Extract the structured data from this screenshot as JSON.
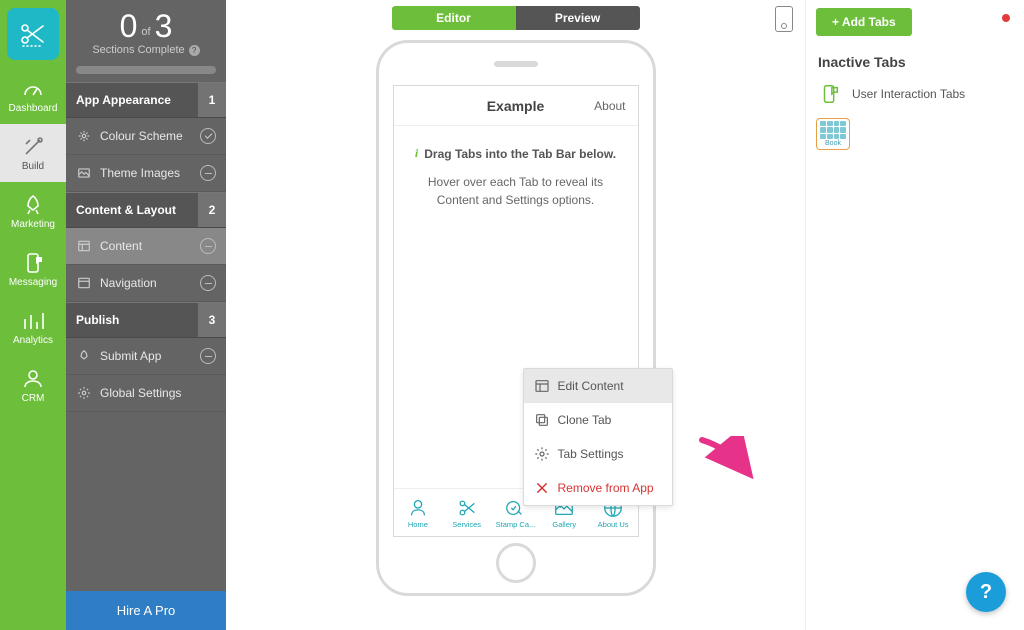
{
  "rail": {
    "items": [
      {
        "label": "Dashboard"
      },
      {
        "label": "Build"
      },
      {
        "label": "Marketing"
      },
      {
        "label": "Messaging"
      },
      {
        "label": "Analytics"
      },
      {
        "label": "CRM"
      }
    ]
  },
  "progress": {
    "done": "0",
    "of_word": "of",
    "total": "3",
    "subtitle": "Sections Complete"
  },
  "sidebar": {
    "sections": [
      {
        "title": "App Appearance",
        "step": "1",
        "items": [
          {
            "label": "Colour Scheme"
          },
          {
            "label": "Theme Images"
          }
        ]
      },
      {
        "title": "Content & Layout",
        "step": "2",
        "items": [
          {
            "label": "Content"
          },
          {
            "label": "Navigation"
          }
        ]
      },
      {
        "title": "Publish",
        "step": "3",
        "items": [
          {
            "label": "Submit App"
          },
          {
            "label": "Global Settings"
          }
        ]
      }
    ],
    "hire": "Hire A Pro"
  },
  "topbar": {
    "editor": "Editor",
    "preview": "Preview"
  },
  "screen": {
    "title": "Example",
    "about": "About",
    "hint_line1": "Drag Tabs into the Tab Bar below.",
    "hint_line2": "Hover over each Tab to reveal its Content and Settings options."
  },
  "tabbar": [
    {
      "label": "Home"
    },
    {
      "label": "Services"
    },
    {
      "label": "Stamp Ca..."
    },
    {
      "label": "Gallery"
    },
    {
      "label": "About Us"
    }
  ],
  "ctx": {
    "edit": "Edit Content",
    "clone": "Clone Tab",
    "settings": "Tab Settings",
    "remove": "Remove from App"
  },
  "right": {
    "add": "+ Add Tabs",
    "inactive_heading": "Inactive Tabs",
    "inactive": [
      {
        "label": "User Interaction Tabs"
      }
    ],
    "book_label": "Book"
  }
}
